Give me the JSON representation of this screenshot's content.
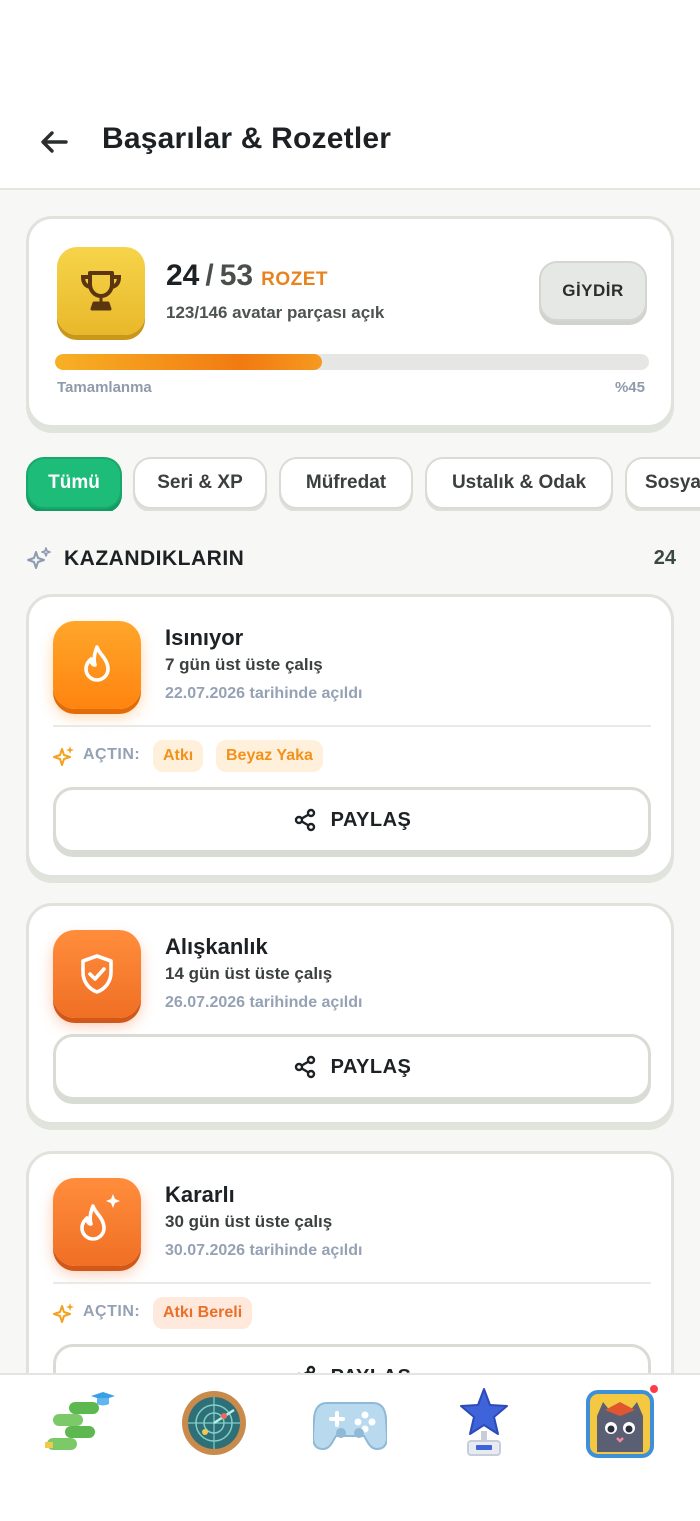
{
  "header": {
    "title": "Başarılar & Rozetler",
    "back_icon": "arrow-left-icon"
  },
  "summary": {
    "earned": "24",
    "separator": "/",
    "total": "53",
    "unit": "ROZET",
    "avatar_parts": "123/146 avatar parçası açık",
    "wear_button": "GİYDİR",
    "progress_label": "Tamamlanma",
    "progress_percent": "%45",
    "progress_fraction": 0.45,
    "icon": "trophy-icon"
  },
  "filters": [
    "Tümü",
    "Seri & XP",
    "Müfredat",
    "Ustalık & Odak",
    "Sosyal"
  ],
  "section": {
    "title": "KAZANDIKLARIN",
    "count": "24",
    "icon": "sparkles-icon"
  },
  "badges": [
    {
      "name": "Isınıyor",
      "desc": "7 gün üst üste çalış",
      "date": "22.07.2026 tarihinde açıldı",
      "unlock_label": "AÇTIN:",
      "tags": [
        "Atkı",
        "Beyaz Yaka"
      ],
      "share": "PAYLAŞ",
      "icon": "flame-icon"
    },
    {
      "name": "Alışkanlık",
      "desc": "14 gün üst üste çalış",
      "date": "26.07.2026 tarihinde açıldı",
      "share": "PAYLAŞ",
      "icon": "shield-check-icon"
    },
    {
      "name": "Kararlı",
      "desc": "30 gün üst üste çalış",
      "date": "30.07.2026 tarihinde açıldı",
      "unlock_label": "AÇTIN:",
      "tags": [
        "Atkı Bereli"
      ],
      "share": "PAYLAŞ",
      "icon": "flame-sparkle-icon"
    }
  ],
  "bottom_nav": [
    "learning-path-icon",
    "radar-globe-icon",
    "gamepad-icon",
    "star-trophy-icon",
    "cat-avatar-icon"
  ],
  "colors": {
    "accent_green": "#1dbd79",
    "orange": "#f27a12",
    "gold": "#f6d44a",
    "notification": "#ff3b4a"
  }
}
